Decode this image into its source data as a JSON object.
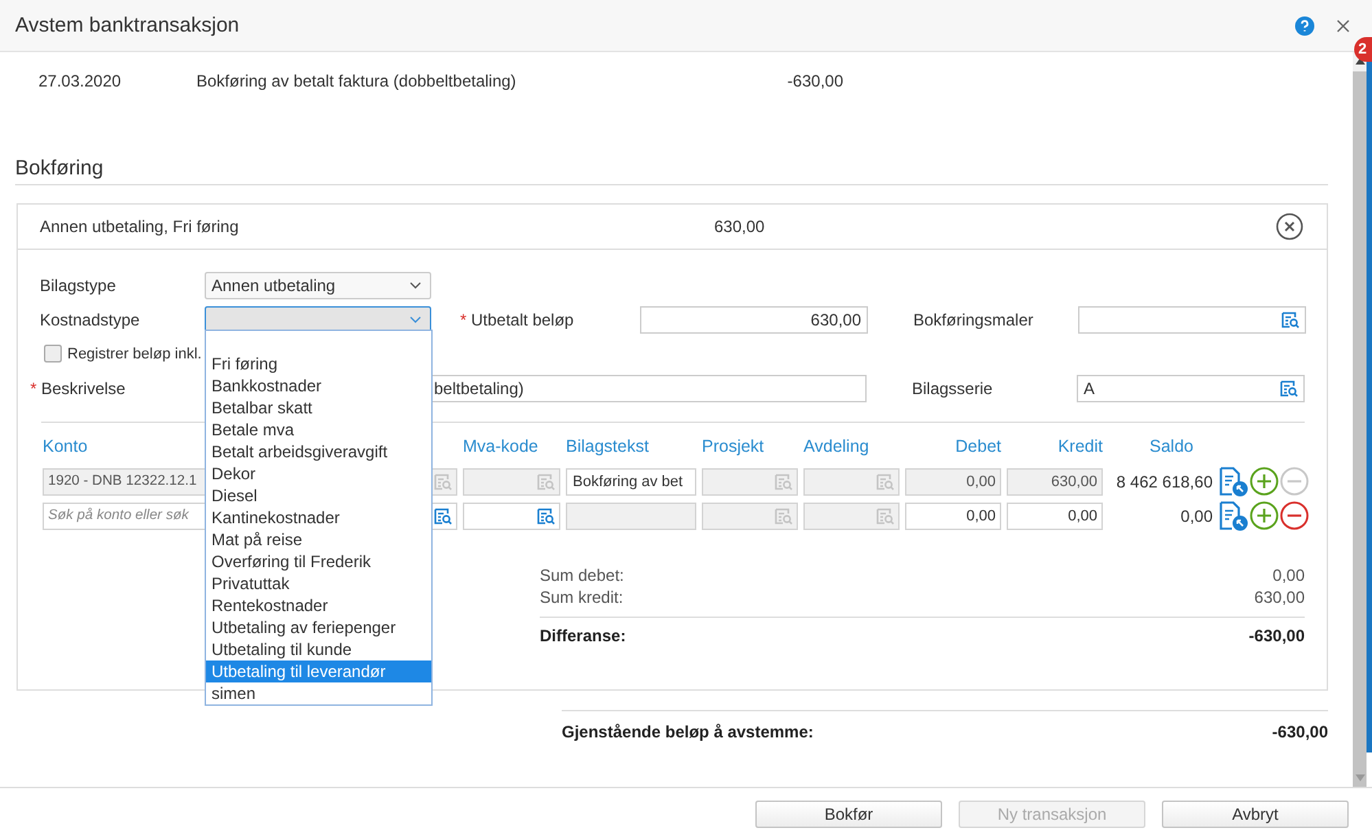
{
  "window": {
    "title": "Avstem banktransaksjon",
    "badge": "2"
  },
  "transaction": {
    "date": "27.03.2020",
    "description": "Bokføring av betalt faktura (dobbeltbetaling)",
    "amount": "-630,00"
  },
  "section_title": "Bokføring",
  "entry": {
    "title": "Annen utbetaling, Fri føring",
    "amount": "630,00"
  },
  "form": {
    "bilagstype": {
      "label": "Bilagstype",
      "value": "Annen utbetaling",
      "expanded": false
    },
    "kostnadstype": {
      "label": "Kostnadstype",
      "expanded": true
    },
    "utbetalt_belop": {
      "marker": "*",
      "label": "Utbetalt beløp",
      "value": "630,00"
    },
    "bokforingsmaler": {
      "label": "Bokføringsmaler"
    },
    "register_incl": {
      "label": "Registrer beløp inkl.",
      "checked": false
    },
    "beskrivelse": {
      "marker": "*",
      "label": "Beskrivelse",
      "value": "beltbetaling)"
    },
    "bilagsserie": {
      "label": "Bilagsserie",
      "value": "A"
    }
  },
  "dropdown": [
    {
      "label": "Fri føring",
      "selected": false
    },
    {
      "label": "Bankkostnader",
      "selected": false
    },
    {
      "label": "Betalbar skatt",
      "selected": false
    },
    {
      "label": "Betale mva",
      "selected": false
    },
    {
      "label": "Betalt arbeidsgiveravgift",
      "selected": false
    },
    {
      "label": "Dekor",
      "selected": false
    },
    {
      "label": "Diesel",
      "selected": false
    },
    {
      "label": "Kantinekostnader",
      "selected": false
    },
    {
      "label": "Mat på reise",
      "selected": false
    },
    {
      "label": "Overføring til Frederik",
      "selected": false
    },
    {
      "label": "Privatuttak",
      "selected": false
    },
    {
      "label": "Rentekostnader",
      "selected": false
    },
    {
      "label": "Utbetaling av feriepenger",
      "selected": false
    },
    {
      "label": "Utbetaling til kunde",
      "selected": false
    },
    {
      "label": "Utbetaling til leverandør",
      "selected": true
    },
    {
      "label": "simen",
      "selected": false
    }
  ],
  "table": {
    "columns": [
      {
        "label": "Konto",
        "kind": "text"
      },
      {
        "label": "Mva-kode",
        "kind": "text"
      },
      {
        "label": "Bilagstekst",
        "kind": "text"
      },
      {
        "label": "Prosjekt",
        "kind": "text"
      },
      {
        "label": "Avdeling",
        "kind": "text"
      },
      {
        "label": "Debet",
        "kind": "number"
      },
      {
        "label": "Kredit",
        "kind": "number"
      },
      {
        "label": "Saldo",
        "kind": "number"
      }
    ],
    "rows": [
      {
        "removable": false,
        "cells": [
          {
            "kind": "lookup",
            "value": "1920 - DNB 12322.12.1",
            "disabled": true
          },
          {
            "kind": "lookup",
            "disabled": true
          },
          {
            "kind": "text",
            "value": "Bokføring av bet",
            "disabled": false
          },
          {
            "kind": "lookup",
            "disabled": true
          },
          {
            "kind": "lookup",
            "disabled": true
          },
          {
            "kind": "number",
            "value": "0,00",
            "disabled": true
          },
          {
            "kind": "number",
            "value": "630,00",
            "disabled": true
          }
        ],
        "saldo": "8 462 618,60"
      },
      {
        "removable": true,
        "cells": [
          {
            "kind": "lookup",
            "placeholder": "Søk på konto eller søk",
            "disabled": false
          },
          {
            "kind": "lookup",
            "disabled": false
          },
          {
            "kind": "text",
            "disabled": true
          },
          {
            "kind": "lookup",
            "disabled": true
          },
          {
            "kind": "lookup",
            "disabled": true
          },
          {
            "kind": "number",
            "value": "0,00",
            "disabled": false
          },
          {
            "kind": "number",
            "value": "0,00",
            "disabled": false
          }
        ],
        "saldo": "0,00"
      }
    ]
  },
  "summary": {
    "sum_debet": {
      "label": "Sum debet:",
      "value": "0,00"
    },
    "sum_kredit": {
      "label": "Sum kredit:",
      "value": "630,00"
    },
    "differanse": {
      "label": "Differanse:",
      "value": "-630,00"
    }
  },
  "remaining": {
    "label": "Gjenstående beløp å avstemme:",
    "value": "-630,00"
  },
  "buttons": [
    {
      "label": "Bokfør",
      "disabled": false
    },
    {
      "label": "Ny transaksjon",
      "disabled": true
    },
    {
      "label": "Avbryt",
      "disabled": false
    }
  ]
}
